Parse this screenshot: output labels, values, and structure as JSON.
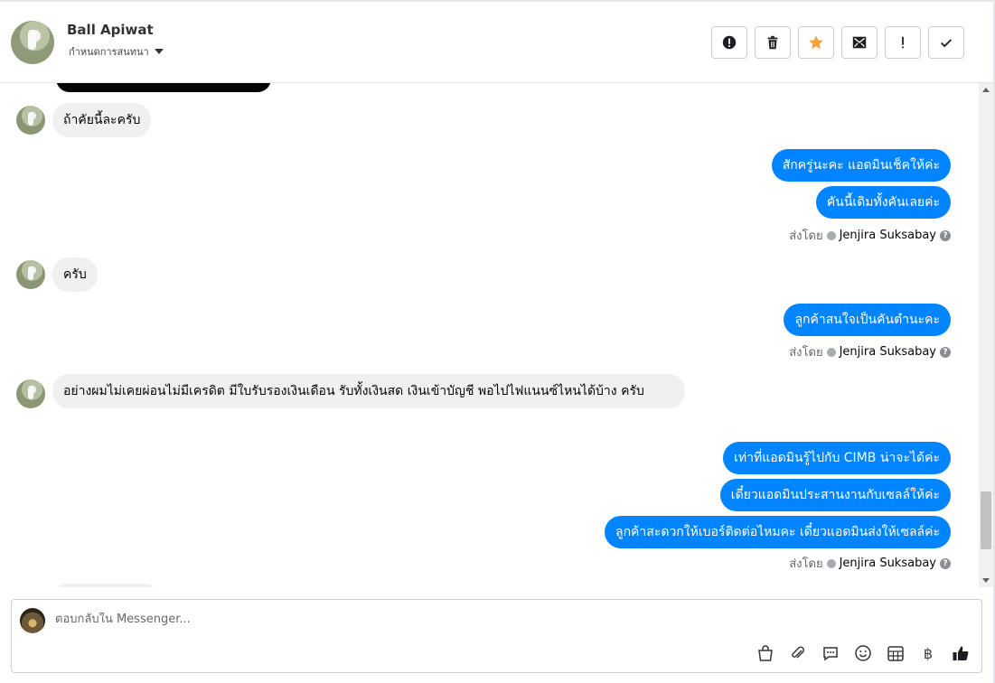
{
  "header": {
    "contact_name": "Ball Apiwat",
    "assign_label": "กำหนดการสนทนา",
    "actions": [
      "mark-spam",
      "delete",
      "star",
      "mark-unread",
      "important",
      "done"
    ]
  },
  "messages": [
    {
      "dir": "in",
      "text": "ถ้าคัยนี้ละครับ"
    },
    {
      "dir": "out",
      "text": "สักครู่นะคะ แอดมินเช็คให้ค่ะ"
    },
    {
      "dir": "out",
      "text": "คันนี้เดิมทั้งคันเลยค่ะ"
    },
    {
      "dir": "in",
      "text": "ครับ"
    },
    {
      "dir": "out",
      "text": "ลูกค้าสนใจเป็นคันตำนะคะ"
    },
    {
      "dir": "in",
      "text": "อย่างผมไม่เคยผ่อนไม่มีเครดิต มีใบรับรองเงินเดือน รับทั้งเงินสด เงินเข้าบัญชี พอไปไฟแนนซ์ไหนได้บ้าง ครับ"
    },
    {
      "dir": "out",
      "text": "เท่าที่แอดมินรู้ไปกับ CIMB น่าจะได้ค่ะ"
    },
    {
      "dir": "out",
      "text": "เดี๋ยวแอดมินประสานงานกับเซลล์ให้ค่ะ"
    },
    {
      "dir": "out",
      "text": "ลูกค้าสะดวกให้เบอร์ติดต่อไหมคะ เดี๋ยวแอดมินส่งให้เซลล์ค่ะ"
    }
  ],
  "sent_by": {
    "prefix": "ส่งโดย",
    "agent": "Jenjira Suksabay",
    "help": "?"
  },
  "composer": {
    "placeholder": "ตอบกลับใน Messenger...",
    "baht_symbol": "฿"
  },
  "colors": {
    "outgoing_bubble": "#0084ff",
    "incoming_bubble": "#f0f0f0",
    "star": "#f5a23a"
  }
}
